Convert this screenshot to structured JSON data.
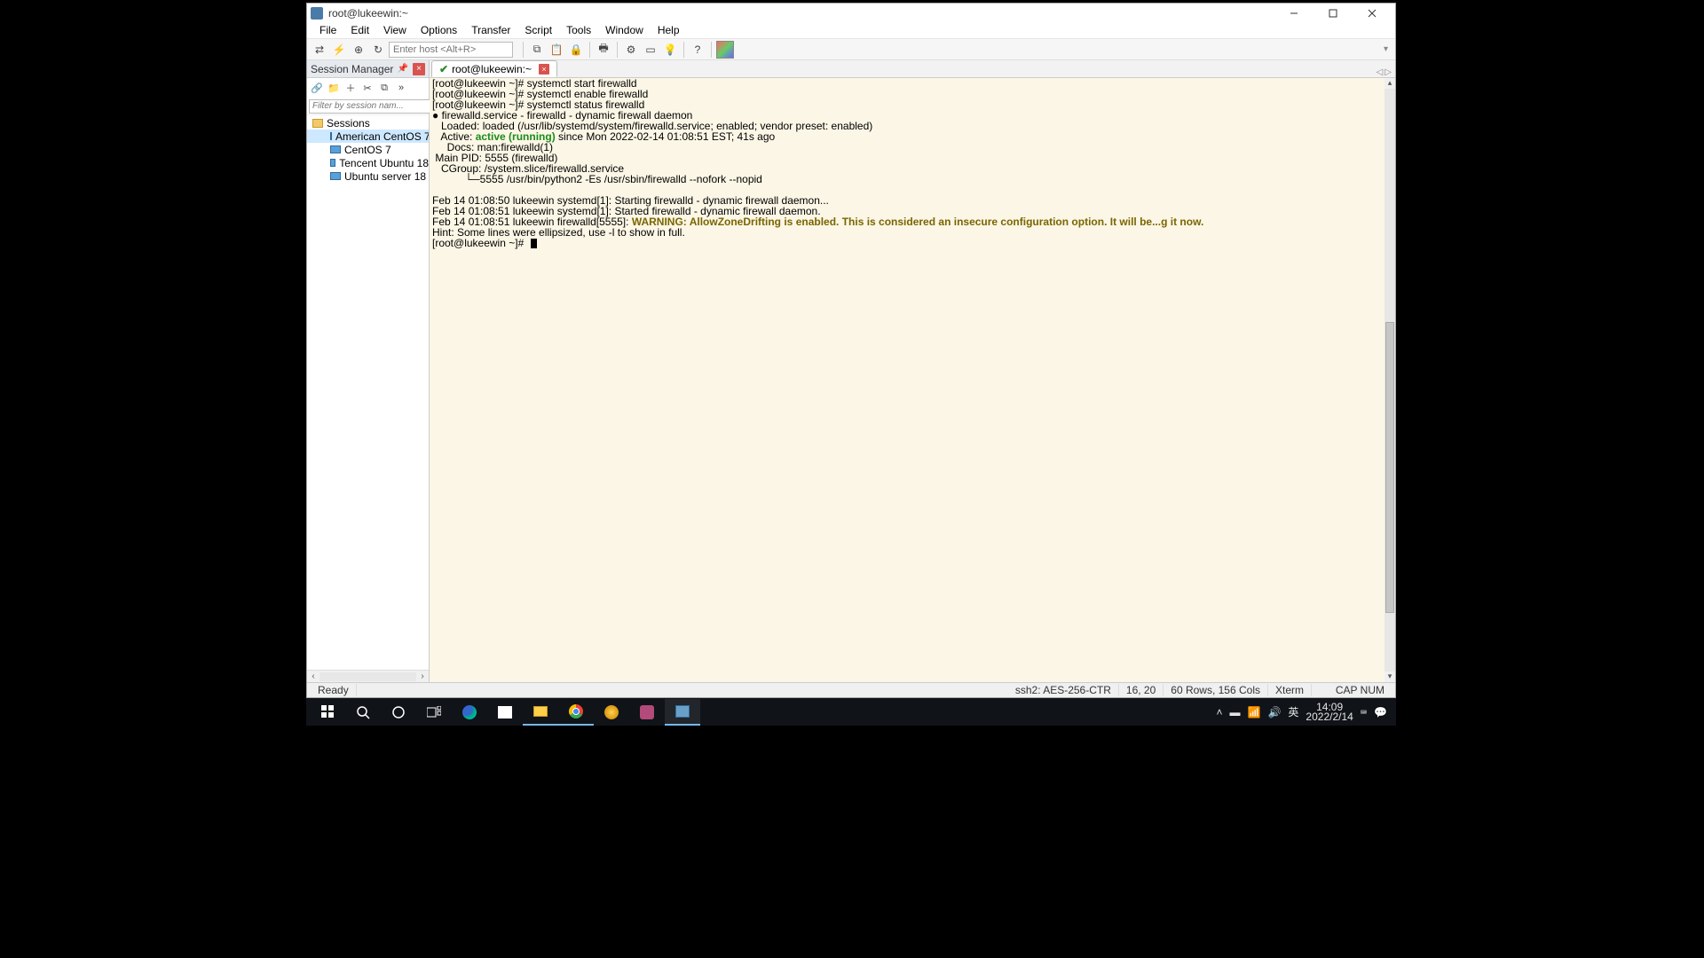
{
  "window": {
    "title": "root@lukeewin:~"
  },
  "menu": [
    "File",
    "Edit",
    "View",
    "Options",
    "Transfer",
    "Script",
    "Tools",
    "Window",
    "Help"
  ],
  "toolbar": {
    "host_placeholder": "Enter host <Alt+R>"
  },
  "session_manager": {
    "title": "Session Manager",
    "filter_placeholder": "Filter by session nam...",
    "root": "Sessions",
    "items": [
      "American CentOS 7",
      "CentOS 7",
      "Tencent Ubuntu 18",
      "Ubuntu server 18"
    ],
    "selected": "American CentOS 7"
  },
  "tab": {
    "label": "root@lukeewin:~"
  },
  "terminal": {
    "lines": [
      {
        "segments": [
          {
            "t": "[root@lukeewin ~]# systemctl start firewalld"
          }
        ]
      },
      {
        "segments": [
          {
            "t": "[root@lukeewin ~]# systemctl enable firewalld"
          }
        ]
      },
      {
        "segments": [
          {
            "t": "[root@lukeewin ~]# systemctl status firewalld"
          }
        ]
      },
      {
        "segments": [
          {
            "t": "● firewalld.service - firewalld - dynamic firewall daemon"
          }
        ]
      },
      {
        "segments": [
          {
            "t": "   Loaded: loaded (/usr/lib/systemd/system/firewalld.service; enabled; vendor preset: enabled)"
          }
        ]
      },
      {
        "segments": [
          {
            "t": "   Active: "
          },
          {
            "t": "active (running)",
            "cls": "green"
          },
          {
            "t": " since Mon 2022-02-14 01:08:51 EST; 41s ago"
          }
        ]
      },
      {
        "segments": [
          {
            "t": "     Docs: man:firewalld(1)"
          }
        ]
      },
      {
        "segments": [
          {
            "t": " Main PID: 5555 (firewalld)"
          }
        ]
      },
      {
        "segments": [
          {
            "t": "   CGroup: /system.slice/firewalld.service"
          }
        ]
      },
      {
        "segments": [
          {
            "t": "           └─5555 /usr/bin/python2 -Es /usr/sbin/firewalld --nofork --nopid"
          }
        ]
      },
      {
        "segments": [
          {
            "t": ""
          }
        ]
      },
      {
        "segments": [
          {
            "t": "Feb 14 01:08:50 lukeewin systemd[1]: Starting firewalld - dynamic firewall daemon..."
          }
        ]
      },
      {
        "segments": [
          {
            "t": "Feb 14 01:08:51 lukeewin systemd[1]: Started firewalld - dynamic firewall daemon."
          }
        ]
      },
      {
        "segments": [
          {
            "t": "Feb 14 01:08:51 lukeewin firewalld[5555]: "
          },
          {
            "t": "WARNING: AllowZoneDrifting is enabled. This is considered an insecure configuration option. It will be...g it now.",
            "cls": "yellow-bold"
          }
        ]
      },
      {
        "segments": [
          {
            "t": "Hint: Some lines were ellipsized, use -l to show in full."
          }
        ]
      },
      {
        "segments": [
          {
            "t": "[root@lukeewin ~]# "
          }
        ],
        "cursor": true
      }
    ]
  },
  "status": {
    "ready": "Ready",
    "conn": "ssh2: AES-256-CTR",
    "pos": "16,  20",
    "size": "60 Rows, 156 Cols",
    "emul": "Xterm",
    "caps": "CAP NUM"
  },
  "tray": {
    "ime": "英",
    "time": "14:09",
    "date": "2022/2/14"
  }
}
